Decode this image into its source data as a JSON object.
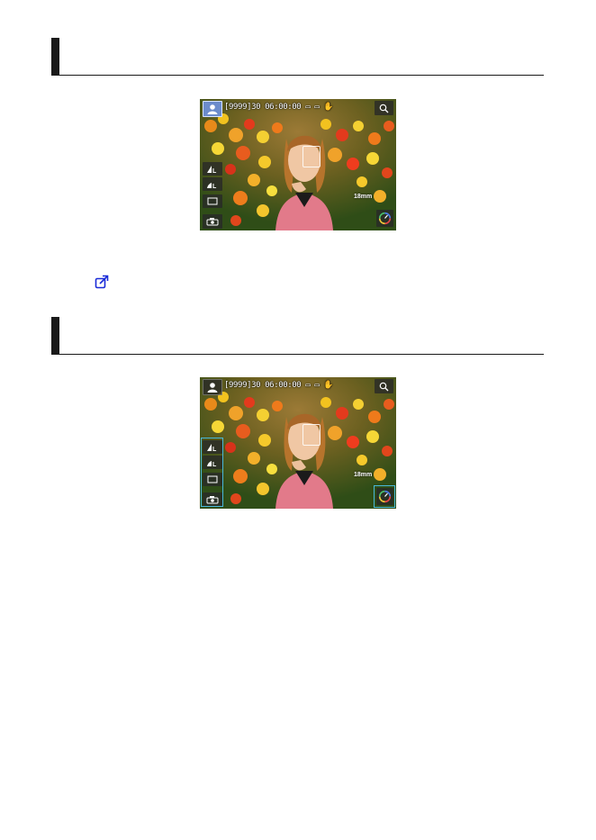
{
  "sections": [
    {
      "title": ""
    },
    {
      "title": ""
    }
  ],
  "screen": {
    "topbar_text": "[9999]30  06:00:00 ▭ ▭ ✋",
    "focal_length": "18mm",
    "icons": {
      "mode": "portrait-person-icon",
      "zoom": "magnifier-icon",
      "size_large": "image-size-large-icon",
      "size_small": "image-size-small-icon",
      "drive": "single-shot-frame-icon",
      "filter": "background-blur-icon",
      "creative": "creative-assist-dial-icon"
    }
  },
  "link_icon": "cross-reference-link-icon",
  "colors": {
    "highlight": "#49b8d8",
    "mode_button": "#6c8ccc",
    "link": "#1a2bd8"
  }
}
